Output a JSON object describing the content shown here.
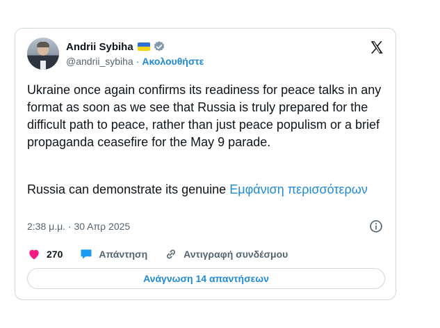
{
  "author": {
    "name": "Andrii Sybiha",
    "handle": "@andrii_sybiha",
    "separator": "·",
    "follow_label": "Ακολουθήστε"
  },
  "icons": {
    "flag": "ukraine-flag-icon",
    "verified": "verified-badge-icon",
    "logo": "x-logo-icon",
    "info": "info-icon",
    "like": "heart-icon",
    "reply": "speech-bubble-icon",
    "copy": "link-icon"
  },
  "colors": {
    "accent": "#1d8ad9",
    "like": "#f91880",
    "reply": "#1d9bf0"
  },
  "tweet": {
    "paragraph1": "Ukraine once again confirms its readiness for peace talks in any format as soon as we see that Russia is truly prepared for the difficult path to peace, rather than just peace populism or a brief propaganda ceasefire for the May 9 parade.",
    "paragraph2": "Russia can demonstrate its genuine",
    "show_more": "Εμφάνιση περισσότερων",
    "timestamp": "2:38 μ.μ. · 30 Απρ 2025"
  },
  "actions": {
    "like_count": "270",
    "reply_label": "Απάντηση",
    "copy_link_label": "Αντιγραφή συνδέσμου"
  },
  "read_replies_label": "Ανάγνωση 14 απαντήσεων"
}
